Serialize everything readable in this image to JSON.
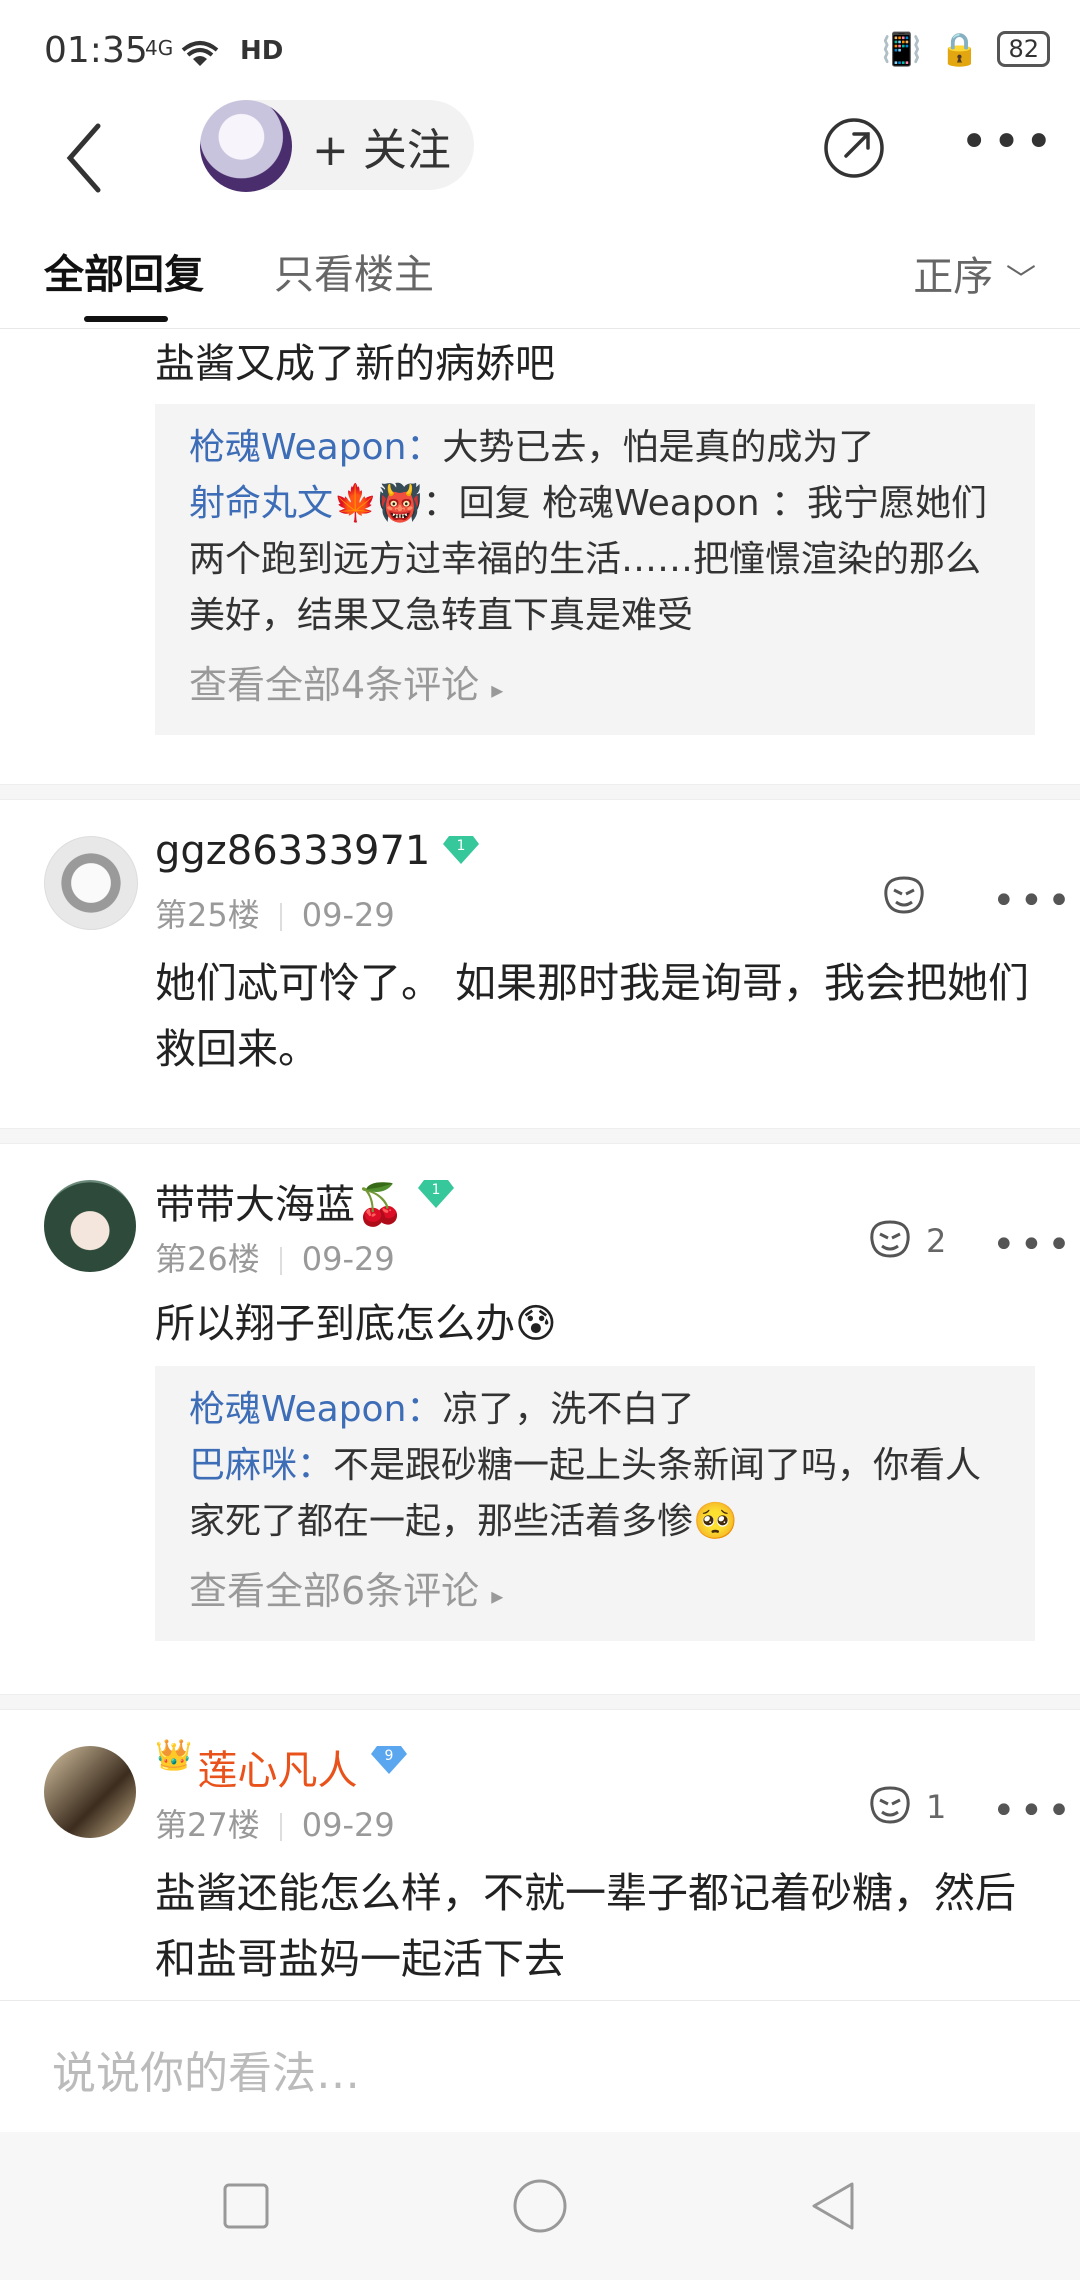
{
  "status_bar": {
    "time": "01:35",
    "signal": "4G",
    "battery": "82"
  },
  "header": {
    "follow_label": "+ 关注"
  },
  "tabs": {
    "all": "全部回复",
    "owner_only": "只看楼主",
    "sort": "正序"
  },
  "top_post": {
    "text": "盐酱又成了新的病娇吧",
    "replies": [
      {
        "name": "枪魂Weapon：",
        "text": "大势已去，怕是真的成为了"
      },
      {
        "name": "射命丸文",
        "text": "：回复 枪魂Weapon ：我宁愿她们两个跑到远方过幸福的生活……把憧憬渲染的那么美好，结果又急转直下真是难受"
      }
    ],
    "view_all": "查看全部4条评论"
  },
  "comments": [
    {
      "username": "ggz86333971",
      "level": "1",
      "floor": "第25楼",
      "date": "09-29",
      "likes": "",
      "text": "她们忒可怜了。 如果那时我是询哥，我会把她们救回来。"
    },
    {
      "username": "带带大海蓝🍒",
      "level": "1",
      "floor": "第26楼",
      "date": "09-29",
      "likes": "2",
      "text": "所以翔子到底怎么办😰",
      "replies": [
        {
          "name": "枪魂Weapon：",
          "text": "凉了，洗不白了"
        },
        {
          "name": "巴麻咪：",
          "text": "不是跟砂糖一起上头条新闻了吗，你看人家死了都在一起，那些活着多惨🥺"
        }
      ],
      "view_all": "查看全部6条评论"
    },
    {
      "username": "莲心凡人",
      "level": "9",
      "floor": "第27楼",
      "date": "09-29",
      "likes": "1",
      "text": "盐酱还能怎么样，不就一辈子都记着砂糖，然后和盐哥盐妈一起活下去"
    }
  ],
  "input": {
    "placeholder": "说说你的看法…"
  },
  "colors": {
    "link": "#3d6db6",
    "vip_name": "#e9531b",
    "badge_green": "#36c79a",
    "badge_blue": "#5aa7f0"
  }
}
